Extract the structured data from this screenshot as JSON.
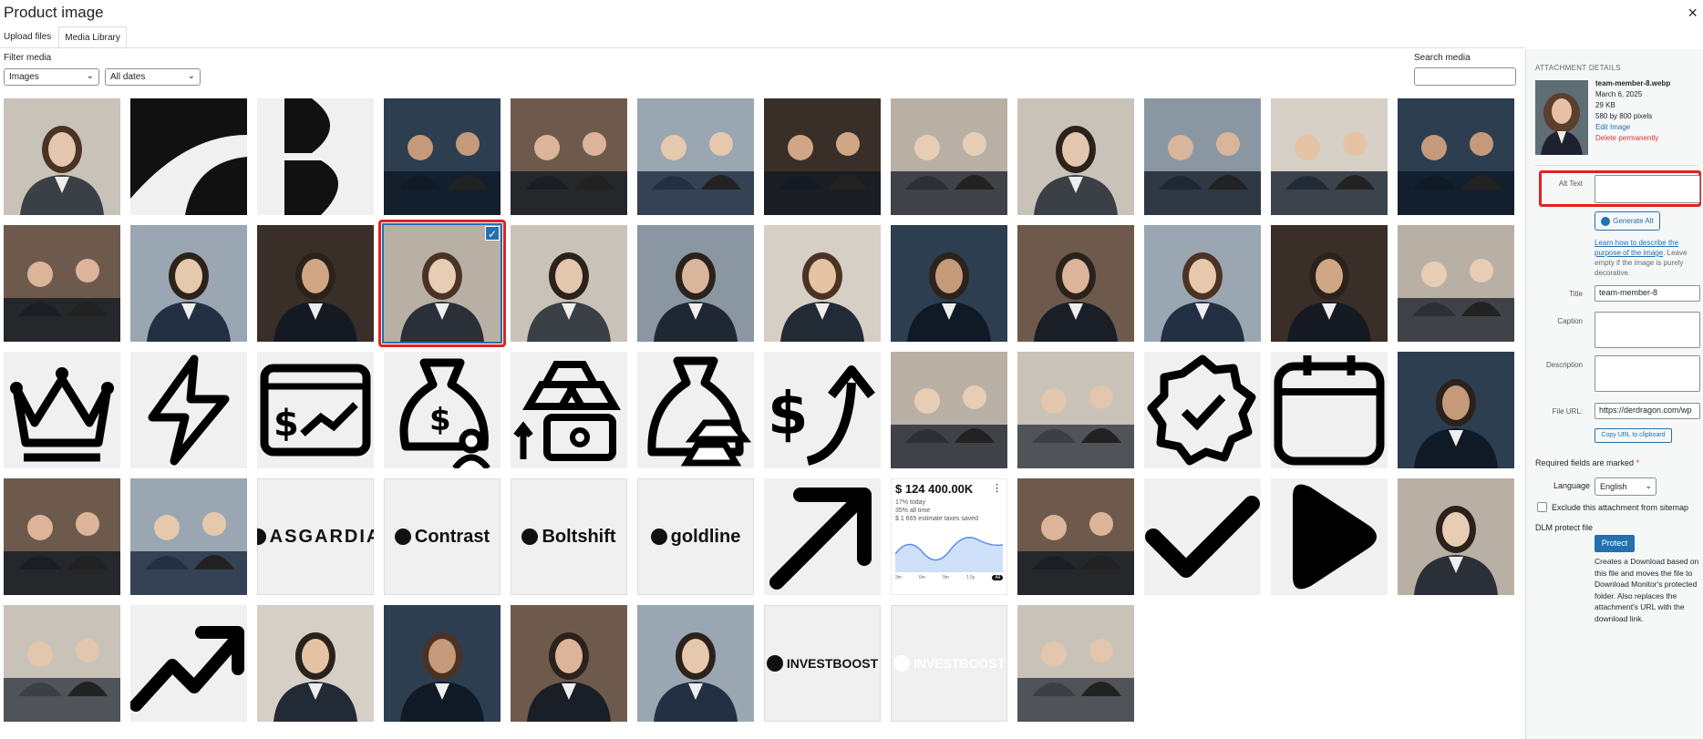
{
  "modal": {
    "title": "Product image",
    "close": "×"
  },
  "tabs": [
    {
      "label": "Upload files",
      "active": false
    },
    {
      "label": "Media Library",
      "active": true
    }
  ],
  "filters": {
    "label": "Filter media",
    "type_value": "Images",
    "date_value": "All dates"
  },
  "search": {
    "label": "Search media",
    "value": ""
  },
  "grid": {
    "selected_index": 15,
    "items": [
      {
        "kind": "photo",
        "name": "man-tablet-smiling"
      },
      {
        "kind": "graphic",
        "name": "dark-abstract-shape-1"
      },
      {
        "kind": "graphic",
        "name": "dark-abstract-shape-2"
      },
      {
        "kind": "photo",
        "name": "business-meeting"
      },
      {
        "kind": "photo",
        "name": "advisor-meeting"
      },
      {
        "kind": "photo",
        "name": "charts-pen"
      },
      {
        "kind": "photo",
        "name": "laptop-discussion"
      },
      {
        "kind": "photo",
        "name": "trading-screens"
      },
      {
        "kind": "photo",
        "name": "man-phone-desk"
      },
      {
        "kind": "photo",
        "name": "tablet-chart"
      },
      {
        "kind": "photo",
        "name": "handshake"
      },
      {
        "kind": "photo",
        "name": "growth-chart-hand"
      },
      {
        "kind": "photo",
        "name": "women-handshake"
      },
      {
        "kind": "photo",
        "name": "woman-laptop"
      },
      {
        "kind": "photo",
        "name": "man-suit-1"
      },
      {
        "kind": "photo",
        "name": "team-member-8"
      },
      {
        "kind": "photo",
        "name": "man-suit-2"
      },
      {
        "kind": "photo",
        "name": "woman-city"
      },
      {
        "kind": "photo",
        "name": "woman-blue-blazer"
      },
      {
        "kind": "photo",
        "name": "man-suit-3"
      },
      {
        "kind": "photo",
        "name": "woman-dark-hair"
      },
      {
        "kind": "photo",
        "name": "man-grey-suit"
      },
      {
        "kind": "photo",
        "name": "young-man-portrait"
      },
      {
        "kind": "photo",
        "name": "office-desks"
      },
      {
        "kind": "icon",
        "name": "crown-icon"
      },
      {
        "kind": "icon",
        "name": "lightning-icon"
      },
      {
        "kind": "icon",
        "name": "dollar-chart-window-icon"
      },
      {
        "kind": "icon",
        "name": "money-bag-person-icon"
      },
      {
        "kind": "icon",
        "name": "gold-bars-cycle-icon"
      },
      {
        "kind": "icon",
        "name": "money-bag-gold-icon"
      },
      {
        "kind": "icon",
        "name": "dollar-arrow-up-icon"
      },
      {
        "kind": "photo",
        "name": "team-documents"
      },
      {
        "kind": "photo",
        "name": "team-writing"
      },
      {
        "kind": "icon",
        "name": "verified-badge-icon"
      },
      {
        "kind": "icon",
        "name": "calendar-icon"
      },
      {
        "kind": "photo",
        "name": "man-laptop-dark"
      },
      {
        "kind": "photo",
        "name": "laptop-coffee"
      },
      {
        "kind": "photo",
        "name": "dark-blue-light"
      },
      {
        "kind": "logo",
        "name": "asgardia-logo",
        "text": "ASGARDIA"
      },
      {
        "kind": "logo",
        "name": "contrast-logo",
        "text": "Contrast"
      },
      {
        "kind": "logo",
        "name": "boltshift-logo",
        "text": "Boltshift"
      },
      {
        "kind": "logo",
        "name": "goldline-logo",
        "text": "goldline"
      },
      {
        "kind": "icon",
        "name": "arrow-up-right-icon"
      },
      {
        "kind": "widget",
        "name": "finance-widget",
        "amount": "$ 124 400.00K",
        "l1": "17% today",
        "l2": "35% all time",
        "l3": "$ 1 665 estimate taxes saved",
        "ranges": [
          "3m",
          "6m",
          "9m",
          "1.5y",
          "All"
        ]
      },
      {
        "kind": "photo",
        "name": "hair-closeup"
      },
      {
        "kind": "icon",
        "name": "checkmark-icon"
      },
      {
        "kind": "icon",
        "name": "play-icon"
      },
      {
        "kind": "photo",
        "name": "man-glasses-phone"
      },
      {
        "kind": "photo",
        "name": "teal-phone-3d"
      },
      {
        "kind": "icon",
        "name": "trend-up-icon"
      },
      {
        "kind": "photo",
        "name": "man-portrait-bg"
      },
      {
        "kind": "photo",
        "name": "woman-long-hair"
      },
      {
        "kind": "photo",
        "name": "man-bw-portrait"
      },
      {
        "kind": "photo",
        "name": "woman-yellow-hat"
      },
      {
        "kind": "logo",
        "name": "investboost-logo-dark",
        "text": "INVESTBOOST"
      },
      {
        "kind": "logo",
        "name": "investboost-logo-light",
        "text": "INVESTBOOST"
      },
      {
        "kind": "photo",
        "name": "makeup-artist"
      }
    ]
  },
  "details": {
    "heading": "ATTACHMENT DETAILS",
    "filename": "team-member-8.webp",
    "date": "March 6, 2025",
    "size": "29 KB",
    "dimensions": "580 by 800 pixels",
    "edit_link": "Edit Image",
    "delete_link": "Delete permanently",
    "alt_label": "Alt Text",
    "alt_value": "",
    "generate_alt": "Generate Alt",
    "hint_link": "Learn how to describe the purpose of the image",
    "hint_rest": ". Leave empty if the image is purely decorative.",
    "title_label": "Title",
    "title_value": "team-member-8",
    "caption_label": "Caption",
    "caption_value": "",
    "description_label": "Description",
    "description_value": "",
    "url_label": "File URL:",
    "url_value": "https://derdragon.com/wp",
    "copy_url": "Copy URL to clipboard",
    "required": "Required fields are marked",
    "required_star": "*",
    "language_label": "Language",
    "language_value": "English",
    "exclude_label": "Exclude this attachment from sitemap",
    "dlm_label": "DLM protect file",
    "protect_button": "Protect",
    "dlm_description": "Creates a Download based on this file and moves the file to Download Monitor's protected folder. Also replaces the attachment's URL with the download link."
  },
  "colors": {
    "accent": "#2271b1",
    "highlight": "#e0231f",
    "delete": "#d63638"
  }
}
